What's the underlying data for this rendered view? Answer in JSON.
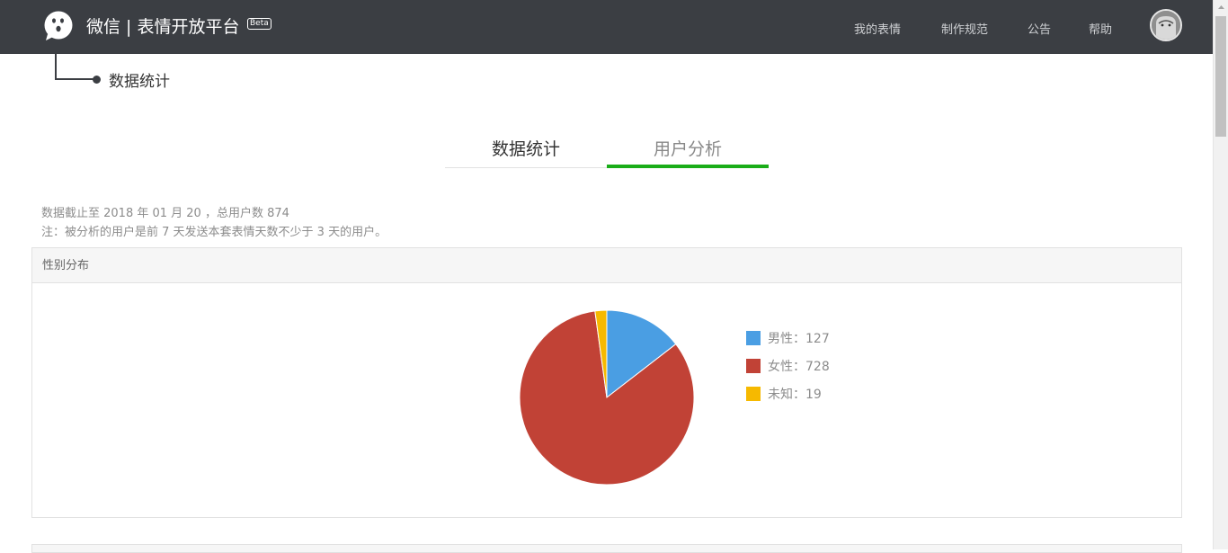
{
  "header": {
    "logo_text": "微信 | 表情开放平台",
    "beta": "Beta",
    "nav": [
      {
        "label": "我的表情"
      },
      {
        "label": "制作规范"
      },
      {
        "label": "公告"
      },
      {
        "label": "帮助"
      }
    ]
  },
  "breadcrumb": {
    "current": "数据统计"
  },
  "tabs": [
    {
      "label": "数据统计",
      "active": false
    },
    {
      "label": "用户分析",
      "active": true
    }
  ],
  "info": {
    "line1": "数据截止至 2018 年 01 月 20 ，总用户数 874",
    "line2": "注：被分析的用户是前 7 天发送本套表情天数不少于 3 天的用户。"
  },
  "panel": {
    "title": "性别分布"
  },
  "colors": {
    "header_bg": "#3b3e43",
    "accent": "#1aad19"
  },
  "chart_data": {
    "type": "pie",
    "title": "性别分布",
    "slices": [
      {
        "label": "男性：127",
        "value": 127,
        "color": "#4a9ee3"
      },
      {
        "label": "女性：728",
        "value": 728,
        "color": "#c14236"
      },
      {
        "label": "未知：19",
        "value": 19,
        "color": "#f6b900"
      }
    ],
    "legend": "right"
  }
}
